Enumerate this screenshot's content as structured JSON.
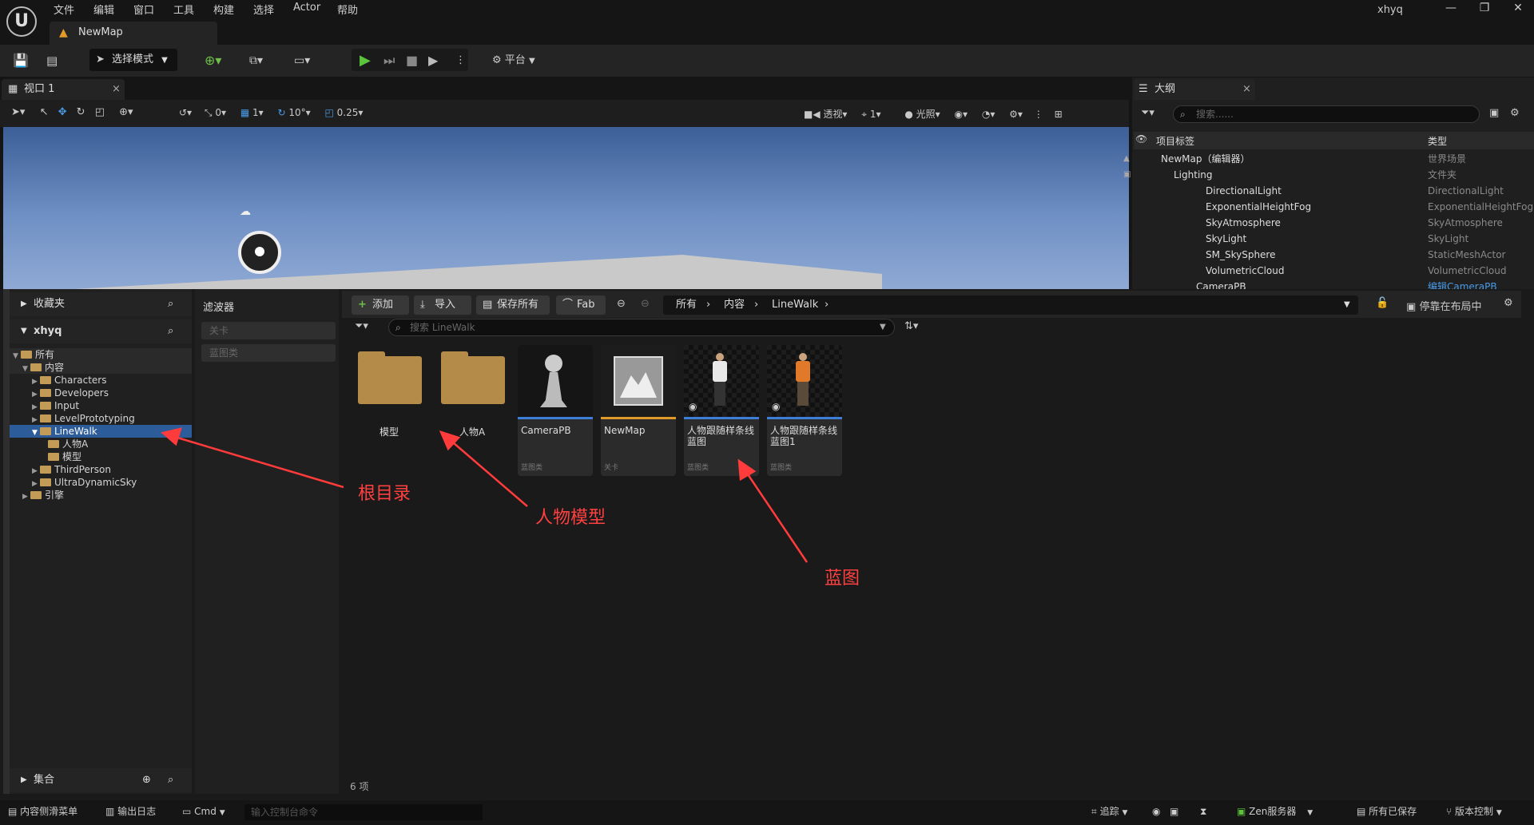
{
  "app": {
    "user": "xhyq",
    "tab_title": "NewMap"
  },
  "menu": [
    "文件",
    "编辑",
    "窗口",
    "工具",
    "构建",
    "选择",
    "Actor",
    "帮助"
  ],
  "toolbar": {
    "mode_label": "选择模式",
    "platform_label": "平台"
  },
  "viewport": {
    "tab_label": "视口 1",
    "snap_values": {
      "translate": "0",
      "grid": "1",
      "rotate": "10°",
      "scale": "0.25"
    },
    "view_mode": "透视",
    "camera_speed": "1",
    "lighting": "光照"
  },
  "outliner": {
    "tab_label": "大纲",
    "search_placeholder": "搜索......",
    "col_label": "项目标签",
    "col_type": "类型",
    "rows": [
      {
        "name": "NewMap（编辑器）",
        "type": "世界场景"
      },
      {
        "name": "Lighting",
        "type": "文件夹"
      },
      {
        "name": "DirectionalLight",
        "type": "DirectionalLight"
      },
      {
        "name": "ExponentialHeightFog",
        "type": "ExponentialHeightFog"
      },
      {
        "name": "SkyAtmosphere",
        "type": "SkyAtmosphere"
      },
      {
        "name": "SkyLight",
        "type": "SkyLight"
      },
      {
        "name": "SM_SkySphere",
        "type": "StaticMeshActor"
      },
      {
        "name": "VolumetricCloud",
        "type": "VolumetricCloud"
      },
      {
        "name": "CameraPB",
        "type": "编辑CameraPB"
      }
    ]
  },
  "sources": {
    "favorites_label": "收藏夹",
    "project_label": "xhyq",
    "collections_label": "集合",
    "tree": [
      {
        "label": "所有"
      },
      {
        "label": "内容"
      },
      {
        "label": "Characters"
      },
      {
        "label": "Developers"
      },
      {
        "label": "Input"
      },
      {
        "label": "LevelPrototyping"
      },
      {
        "label": "LineWalk"
      },
      {
        "label": "人物A"
      },
      {
        "label": "模型"
      },
      {
        "label": "ThirdPerson"
      },
      {
        "label": "UltraDynamicSky"
      },
      {
        "label": "引擎"
      }
    ]
  },
  "filters": {
    "title": "滤波器",
    "chips": [
      "关卡",
      "蓝图类"
    ]
  },
  "content_browser": {
    "add_label": "添加",
    "import_label": "导入",
    "save_all_label": "保存所有",
    "fab_label": "Fab",
    "path": [
      "所有",
      "内容",
      "LineWalk"
    ],
    "dock_label": "停靠在布局中",
    "search_placeholder": "搜索 LineWalk",
    "item_count": "6 项",
    "folders": [
      {
        "name": "模型"
      },
      {
        "name": "人物A"
      }
    ],
    "assets": [
      {
        "name": "CameraPB",
        "class": "蓝图类",
        "accent": "#3d7fd6"
      },
      {
        "name": "NewMap",
        "class": "关卡",
        "accent": "#e09a2a"
      },
      {
        "name": "人物跟随样条线蓝图",
        "class": "蓝图类",
        "accent": "#3d7fd6"
      },
      {
        "name": "人物跟随样条线蓝图1",
        "class": "蓝图类",
        "accent": "#3d7fd6"
      }
    ]
  },
  "annotations": {
    "root": "根目录",
    "model": "人物模型",
    "blueprint": "蓝图"
  },
  "statusbar": {
    "drawer": "内容侧滑菜单",
    "log": "输出日志",
    "cmd": "Cmd",
    "cmd_placeholder": "输入控制台命令",
    "trace": "追踪",
    "zen": "Zen服务器",
    "saved": "所有已保存",
    "vcs": "版本控制"
  }
}
